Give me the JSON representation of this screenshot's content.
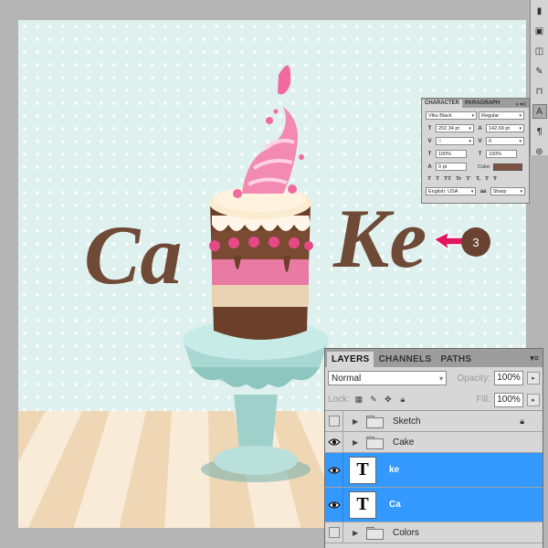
{
  "canvas": {
    "title_letters_left": "Ca",
    "title_letters_right": "Ke",
    "callout_number": "3",
    "colors": {
      "background": "#dff1ef",
      "text_brown": "#6f4a36",
      "pink": "#f06aa0",
      "stand": "#a6d6d0",
      "floor_light": "#f8ecd9",
      "floor_dark": "#efd7b5",
      "arrow": "#e0175f"
    }
  },
  "toolstrip": {
    "tools": [
      "fill-tool",
      "image-tool",
      "layer-comp-tool",
      "brush-tool",
      "stamp-tool",
      "character-tool",
      "paragraph-tool",
      "clone-tool"
    ]
  },
  "character_panel": {
    "tabs": [
      "CHARACTER",
      "PARAGRAPH"
    ],
    "menu_glyph": "»  ▾≡",
    "font_family": "Vtks Black",
    "font_style": "Regular",
    "font_size": "202.34 pt",
    "leading": "142.69 pt",
    "kerning": "0",
    "tracking": "0",
    "vertical_scale": "100%",
    "horizontal_scale": "100%",
    "baseline_shift": "0 pt",
    "color_label": "Color:",
    "color_value": "#7d5240",
    "style_buttons": [
      "T",
      "T",
      "TT",
      "Tr",
      "T'",
      "T,",
      "T",
      "Ŧ"
    ],
    "language": "English: USA",
    "aa_prefix": "aa",
    "antialias": "Sharp"
  },
  "layers_panel": {
    "tabs": [
      "LAYERS",
      "CHANNELS",
      "PATHS"
    ],
    "menu_glyph": "▾≡",
    "blend_mode": "Normal",
    "opacity_label": "Opacity:",
    "opacity_value": "100%",
    "lock_label": "Lock:",
    "fill_label": "Fill:",
    "fill_value": "100%",
    "layers": [
      {
        "name": "Sketch",
        "type": "folder",
        "visible": false,
        "locked": true
      },
      {
        "name": "Cake",
        "type": "folder",
        "visible": true,
        "locked": false
      },
      {
        "name": "ke",
        "type": "text",
        "visible": true,
        "selected": true,
        "thumb": "T"
      },
      {
        "name": "Ca",
        "type": "text",
        "visible": true,
        "selected": true,
        "thumb": "T"
      },
      {
        "name": "Colors",
        "type": "folder",
        "visible": false,
        "locked": false
      }
    ]
  }
}
